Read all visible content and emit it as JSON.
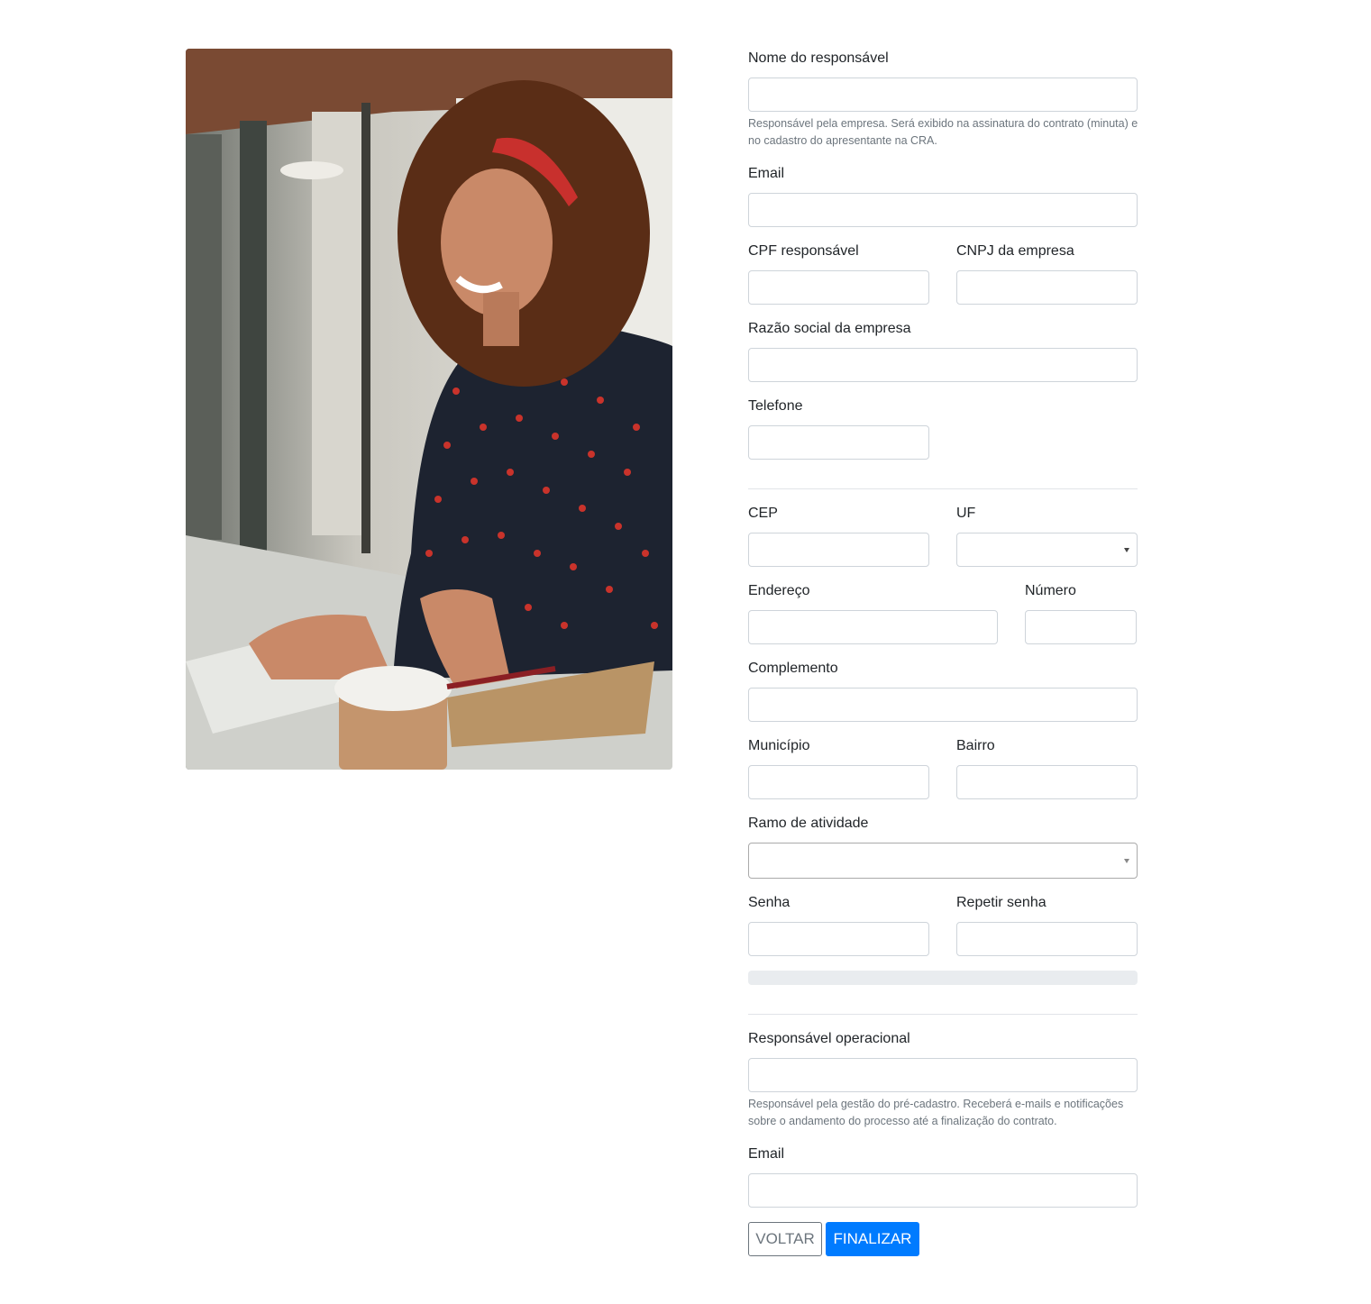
{
  "photo": {
    "description_icon": "woman-at-desk-photo"
  },
  "form": {
    "nome_responsavel": {
      "label": "Nome do responsável",
      "value": "",
      "help": "Responsável pela empresa. Será exibido na assinatura do contrato (minuta) e no cadastro do apresentante na CRA."
    },
    "email": {
      "label": "Email",
      "value": ""
    },
    "cpf_responsavel": {
      "label": "CPF responsável",
      "value": ""
    },
    "cnpj_empresa": {
      "label": "CNPJ da empresa",
      "value": ""
    },
    "razao_social": {
      "label": "Razão social da empresa",
      "value": ""
    },
    "telefone": {
      "label": "Telefone",
      "value": ""
    },
    "cep": {
      "label": "CEP",
      "value": ""
    },
    "uf": {
      "label": "UF",
      "selected": ""
    },
    "endereco": {
      "label": "Endereço",
      "value": ""
    },
    "numero": {
      "label": "Número",
      "value": ""
    },
    "complemento": {
      "label": "Complemento",
      "value": ""
    },
    "municipio": {
      "label": "Município",
      "value": ""
    },
    "bairro": {
      "label": "Bairro",
      "value": ""
    },
    "ramo_atividade": {
      "label": "Ramo de atividade",
      "selected": ""
    },
    "senha": {
      "label": "Senha",
      "value": ""
    },
    "repetir_senha": {
      "label": "Repetir senha",
      "value": ""
    },
    "password_strength": {
      "level": 0
    },
    "responsavel_operacional": {
      "label": "Responsável operacional",
      "value": "",
      "help": "Responsável pela gestão do pré-cadastro. Receberá e-mails e notificações sobre o andamento do processo até a finalização do contrato."
    },
    "email_operacional": {
      "label": "Email",
      "value": ""
    }
  },
  "buttons": {
    "back_label": "VOLTAR",
    "finish_label": "FINALIZAR"
  },
  "colors": {
    "primary": "#007bff",
    "secondary": "#6c757d",
    "border": "#ced4da",
    "meter_track": "#e9ecef"
  }
}
